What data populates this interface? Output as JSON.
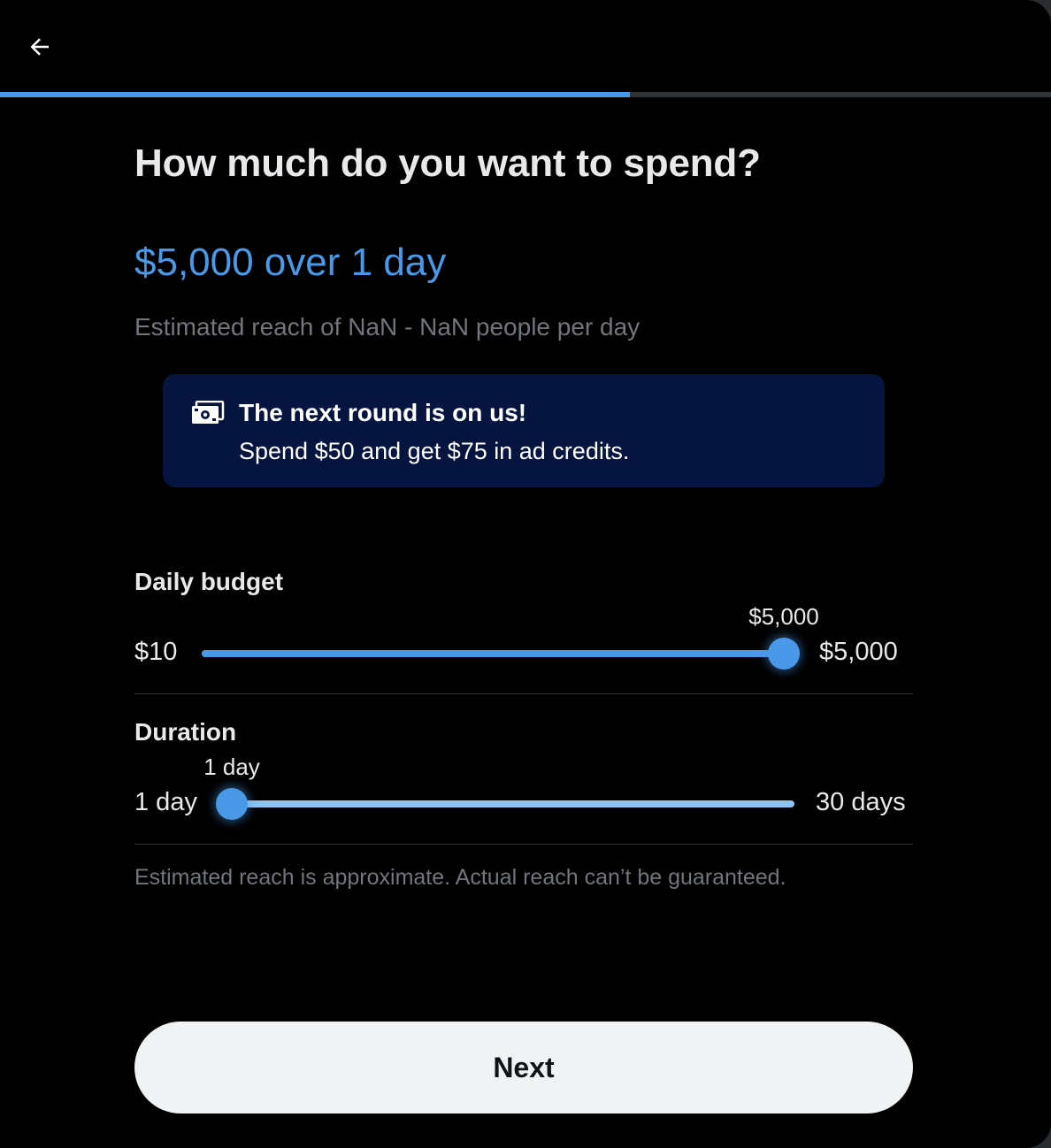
{
  "header": {
    "back_icon": "arrow-left-icon",
    "progress_fraction": 0.6
  },
  "main": {
    "title": "How much do you want to spend?",
    "summary": "$5,000 over 1 day",
    "reach_estimate": "Estimated reach of NaN - NaN people per day"
  },
  "promo": {
    "icon": "money-icon",
    "title": "The next round is on us!",
    "text": "Spend $50 and get $75 in ad credits."
  },
  "daily_budget": {
    "label": "Daily budget",
    "min_label": "$10",
    "max_label": "$5,000",
    "current_label": "$5,000",
    "fraction": 1.0
  },
  "duration": {
    "label": "Duration",
    "min_label": "1 day",
    "max_label": "30 days",
    "current_label": "1 day",
    "fraction": 0.0
  },
  "disclaimer": "Estimated reach is approximate. Actual reach can’t be guaranteed.",
  "footer": {
    "next_label": "Next"
  },
  "colors": {
    "accent": "#4a99e9",
    "promo_bg": "#061440",
    "background": "#000000",
    "button_bg": "#eff3f4"
  }
}
